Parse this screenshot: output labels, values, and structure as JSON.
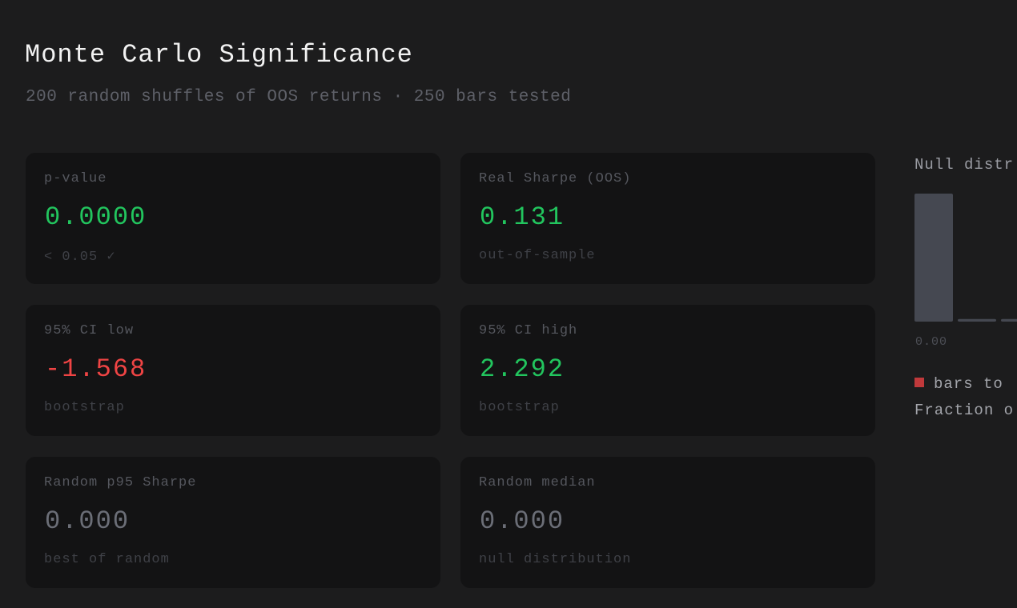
{
  "header": {
    "title": "Monte Carlo Significance",
    "subtitle": "200 random shuffles of OOS returns · 250 bars tested"
  },
  "cards": [
    {
      "label": "p-value",
      "value": "0.0000",
      "sub": "< 0.05 ✓",
      "tone": "green"
    },
    {
      "label": "Real Sharpe (OOS)",
      "value": "0.131",
      "sub": "out-of-sample",
      "tone": "green"
    },
    {
      "label": "95% CI low",
      "value": "-1.568",
      "sub": "bootstrap",
      "tone": "red"
    },
    {
      "label": "95% CI high",
      "value": "2.292",
      "sub": "bootstrap",
      "tone": "green"
    },
    {
      "label": "Random p95 Sharpe",
      "value": "0.000",
      "sub": "best of random",
      "tone": "gray"
    },
    {
      "label": "Random median",
      "value": "0.000",
      "sub": "null distribution",
      "tone": "gray"
    }
  ],
  "distribution": {
    "title": "Null distr",
    "tick_label": "0.00",
    "legend_text": "bars to",
    "note": "Fraction o"
  },
  "chart_data": {
    "type": "bar",
    "values": [
      1.0,
      0.02,
      0.02
    ],
    "colors": {
      "bar": "#454851",
      "legend": "#c0393b"
    }
  },
  "colors": {
    "green": "#22c55e",
    "red": "#ef4444",
    "gray": "#6b6e77",
    "card_bg": "#131314",
    "page_bg": "#1c1c1d"
  }
}
